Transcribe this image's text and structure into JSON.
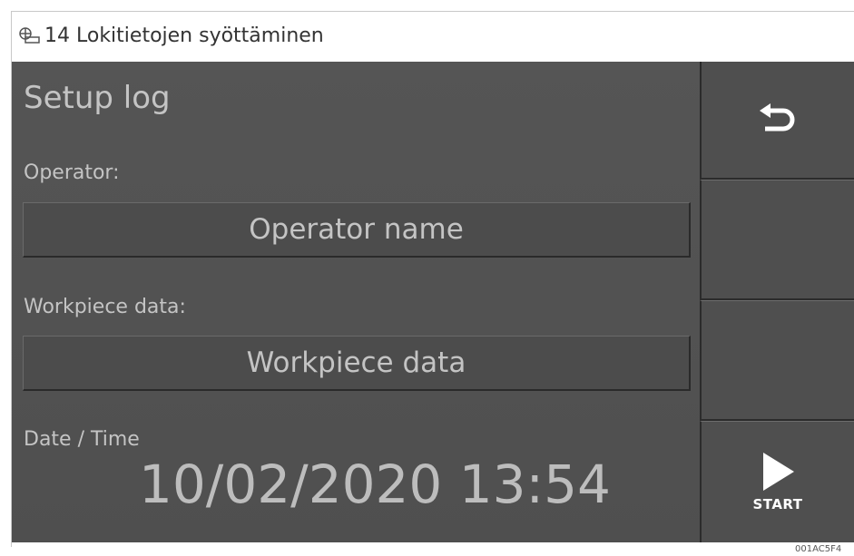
{
  "caption": {
    "text": "14  Lokitietojen syöttäminen"
  },
  "screen": {
    "title": "Setup log",
    "operator": {
      "label": "Operator:",
      "value": "Operator name"
    },
    "workpiece": {
      "label": "Workpiece data:",
      "value": "Workpiece data"
    },
    "datetime": {
      "label": "Date / Time",
      "value": "10/02/2020 13:54"
    }
  },
  "sidebar": {
    "start_label": "START"
  },
  "image_code": "001AC5F4"
}
